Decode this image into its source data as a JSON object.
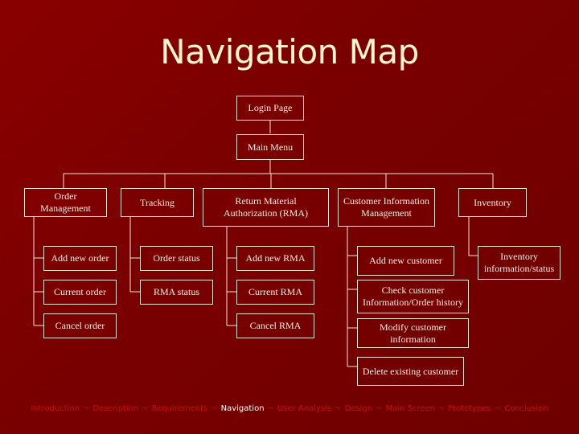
{
  "title": "Navigation Map",
  "diagram": {
    "root": "Login Page",
    "main": "Main Menu",
    "sections": [
      {
        "label": "Order Management",
        "children": [
          "Add new order",
          "Current order",
          "Cancel order"
        ]
      },
      {
        "label": "Tracking",
        "children": [
          "Order status",
          "RMA status"
        ]
      },
      {
        "label": "Return Material Authorization (RMA)",
        "children": [
          "Add new RMA",
          "Current RMA",
          "Cancel RMA"
        ]
      },
      {
        "label": "Customer Information Management",
        "children": [
          "Add new customer",
          "Check customer Information/Order history",
          "Modify customer information",
          "Delete existing customer"
        ]
      },
      {
        "label": "Inventory",
        "children": [
          "Inventory information/status"
        ]
      }
    ]
  },
  "footer": {
    "separator": "~",
    "items": [
      {
        "label": "Introduction",
        "active": false
      },
      {
        "label": "Description",
        "active": false
      },
      {
        "label": "Requirements",
        "active": false
      },
      {
        "label": "Navigation",
        "active": true
      },
      {
        "label": "User Analysis",
        "active": false
      },
      {
        "label": "Design",
        "active": false
      },
      {
        "label": "Main Screen",
        "active": false
      },
      {
        "label": "Prototypes",
        "active": false
      },
      {
        "label": "Conclusion",
        "active": false
      }
    ]
  },
  "colors": {
    "background": "#7a0000",
    "title": "#fff5d0",
    "box_border": "#f2e6d8",
    "footer_inactive": "#c40e0e",
    "footer_active": "#ffffff"
  }
}
